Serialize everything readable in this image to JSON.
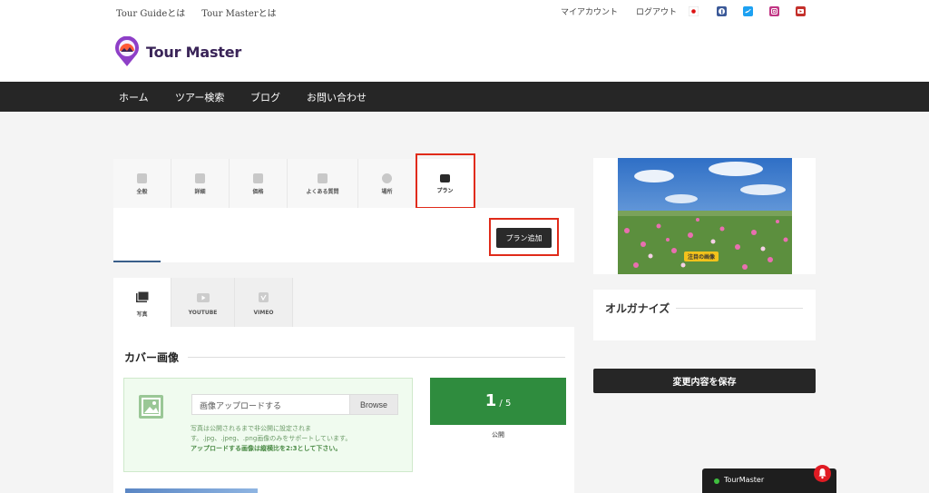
{
  "topbar": {
    "links_left": [
      "Tour Guideとは",
      "Tour Masterとは"
    ],
    "links_right": [
      "マイアカウント",
      "ログアウト"
    ],
    "social": [
      {
        "name": "japan-flag",
        "color": "#ffffff"
      },
      {
        "name": "facebook",
        "color": "#3b5998"
      },
      {
        "name": "twitter",
        "color": "#1da1f2"
      },
      {
        "name": "instagram",
        "color": "#c13584"
      },
      {
        "name": "youtube",
        "color": "#c4302b"
      }
    ]
  },
  "logo": {
    "text": "Tour Master"
  },
  "nav": {
    "items": [
      "ホーム",
      "ツアー検索",
      "ブログ",
      "お問い合わせ"
    ]
  },
  "panel_tabs": [
    {
      "label": "全般",
      "icon": "home-icon"
    },
    {
      "label": "詳細",
      "icon": "info-icon"
    },
    {
      "label": "価格",
      "icon": "price-tag-icon"
    },
    {
      "label": "よくある質問",
      "icon": "question-icon"
    },
    {
      "label": "場所",
      "icon": "map-pin-icon"
    },
    {
      "label": "プラン",
      "icon": "briefcase-icon",
      "active": true
    }
  ],
  "plan": {
    "add_button": "プラン追加"
  },
  "media_tabs": [
    {
      "label": "写真",
      "active": true
    },
    {
      "label": "YOUTUBE"
    },
    {
      "label": "VIMEO"
    }
  ],
  "cover": {
    "title": "カバー画像",
    "input_placeholder": "画像アップロードする",
    "browse_label": "Browse",
    "note_line1": "写真は公開されるまで非公開に設定されます。.jpg、.jpeg、.png画像のみをサポートしています。",
    "note_bold": "アップロードする画像は縦横比を2:3として下さい。",
    "count_current": "1",
    "count_total": " / 5",
    "status": "公開"
  },
  "sidebar": {
    "featured_label": "注目の画像",
    "organize_title": "オルガナイズ",
    "save_button": "変更内容を保存"
  },
  "chat": {
    "label": "TourMaster",
    "status_color": "#3fbf3f"
  },
  "colors": {
    "accent_red": "#e02b1a",
    "green": "#2f8c3e",
    "dark": "#262626"
  }
}
